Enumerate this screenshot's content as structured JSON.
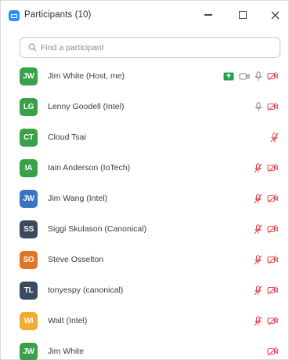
{
  "window": {
    "title": "Participants (10)"
  },
  "search": {
    "placeholder": "Find a participant"
  },
  "colors": {
    "green": "#3aa04a",
    "blue": "#3b73c4",
    "navy": "#3b4a5f",
    "orange": "#e07427",
    "gold": "#f0ad2f",
    "red_icon": "#e8525b",
    "gray_icon": "#8c8c8c",
    "share_green": "#1fa34a"
  },
  "participants": [
    {
      "initials": "JW",
      "name": "Jim White (Host, me)",
      "color": "#3aa04a",
      "icons": [
        "share-screen-icon",
        "video-icon",
        "mic-icon",
        "video-off-icon"
      ]
    },
    {
      "initials": "LG",
      "name": "Lenny Goodell (Intel)",
      "color": "#3aa04a",
      "icons": [
        "mic-icon",
        "video-off-icon"
      ]
    },
    {
      "initials": "CT",
      "name": "Cloud Tsai",
      "color": "#3aa04a",
      "icons": [
        "mic-muted-icon"
      ]
    },
    {
      "initials": "IA",
      "name": "Iain Anderson (IoTech)",
      "color": "#3aa04a",
      "icons": [
        "mic-muted-icon",
        "video-off-icon"
      ]
    },
    {
      "initials": "JW",
      "name": "Jim Wang (Intel)",
      "color": "#3b73c4",
      "icons": [
        "mic-muted-icon",
        "video-off-icon"
      ]
    },
    {
      "initials": "SS",
      "name": "Siggi Skulason (Canonical)",
      "color": "#3b4a5f",
      "icons": [
        "mic-muted-icon",
        "video-off-icon"
      ]
    },
    {
      "initials": "SO",
      "name": "Steve Osselton",
      "color": "#e07427",
      "icons": [
        "mic-muted-icon",
        "video-off-icon"
      ]
    },
    {
      "initials": "TL",
      "name": "tonyespy (canonical)",
      "color": "#3b4a5f",
      "icons": [
        "mic-muted-icon",
        "video-off-icon"
      ]
    },
    {
      "initials": "WI",
      "name": "Walt (Intel)",
      "color": "#f0ad2f",
      "icons": [
        "mic-muted-icon",
        "video-off-icon"
      ]
    },
    {
      "initials": "JW",
      "name": "Jim White",
      "color": "#3aa04a",
      "icons": [
        "video-off-icon"
      ]
    }
  ]
}
